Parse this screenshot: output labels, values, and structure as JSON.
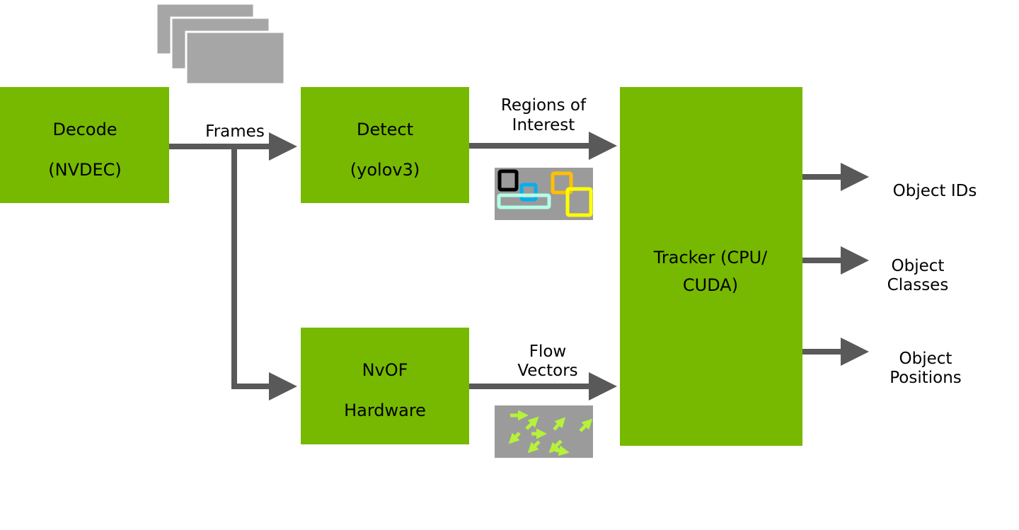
{
  "colors": {
    "block": "#76b900",
    "connector": "#595959",
    "thumbnail": "#9b9b9b",
    "frame": "#a6a6a6",
    "flow_arrow": "#b5f23a"
  },
  "blocks": {
    "decode": {
      "line1": "Decode",
      "line2": "(NVDEC)"
    },
    "detect": {
      "line1": "Detect",
      "line2": "(yolov3)"
    },
    "nvof": {
      "line1": "NvOF",
      "line2": "Hardware"
    },
    "tracker": {
      "line1": "Tracker (CPU/",
      "line2": "CUDA)"
    }
  },
  "edges": {
    "frames": "Frames",
    "roi": {
      "line1": "Regions of",
      "line2": "Interest"
    },
    "flow": {
      "line1": "Flow",
      "line2": "Vectors"
    }
  },
  "outputs": {
    "ids": {
      "line1": "Object IDs"
    },
    "classes": {
      "line1": "Object",
      "line2": "Classes"
    },
    "positions": {
      "line1": "Object",
      "line2": "Positions"
    }
  },
  "roi_box_colors": [
    "#000000",
    "#00b0f0",
    "#b3ffe6",
    "#ffc000",
    "#ffff00"
  ]
}
